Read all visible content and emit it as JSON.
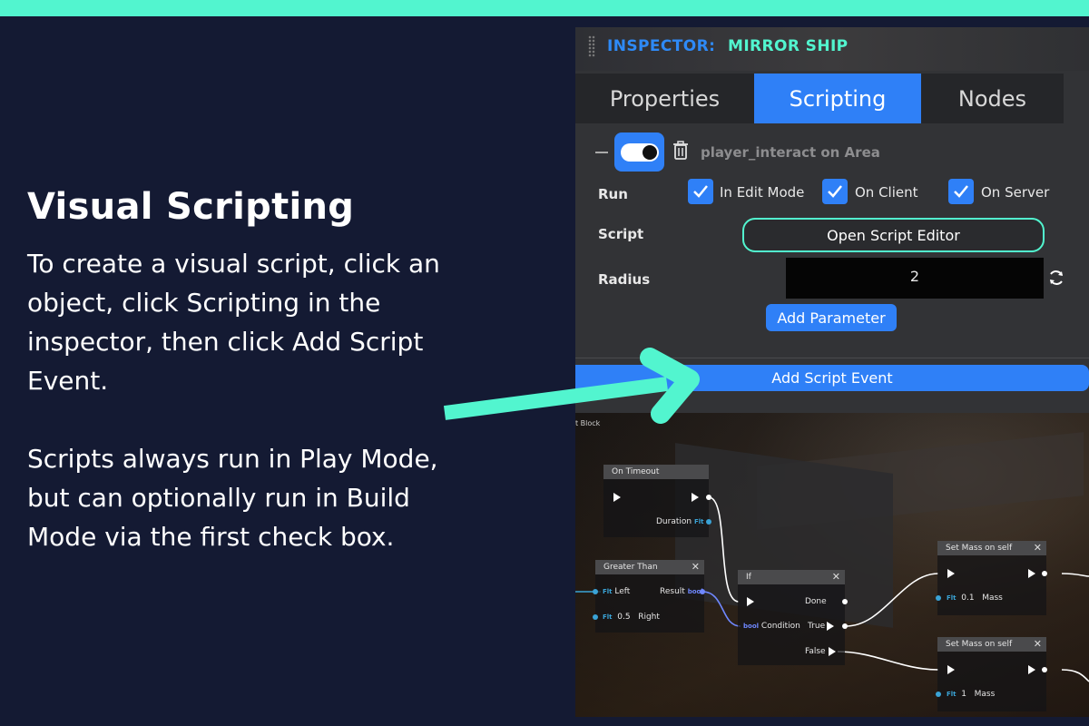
{
  "colors": {
    "accent_teal": "#52f5cf",
    "accent_blue": "#2f80f7",
    "background": "#141a33"
  },
  "tutorial": {
    "title": "Visual Scripting",
    "paragraph1": "To create a visual script, click an object, click Scripting in the inspector, then click Add Script Event.",
    "paragraph2": "Scripts always run in Play Mode, but can optionally run in Build Mode via the first check box."
  },
  "inspector": {
    "title": "INSPECTOR:",
    "object_name": "MIRROR SHIP",
    "tabs": [
      {
        "label": "Properties",
        "active": false
      },
      {
        "label": "Scripting",
        "active": true
      },
      {
        "label": "Nodes",
        "active": false
      }
    ],
    "event": {
      "name": "player_interact on Area",
      "enabled": true,
      "run_label": "Run",
      "run_options": [
        {
          "label": "In Edit Mode",
          "checked": true
        },
        {
          "label": "On Client",
          "checked": true
        },
        {
          "label": "On Server",
          "checked": true
        }
      ],
      "script_label": "Script",
      "open_script_editor": "Open Script Editor",
      "radius_label": "Radius",
      "radius_value": "2",
      "add_parameter": "Add Parameter"
    },
    "add_script_event": "Add Script Event"
  },
  "graph": {
    "corner_label": "t Block",
    "type_tags": {
      "float": "Flt",
      "bool": "bool"
    },
    "nodes": {
      "on_timeout": {
        "title": "On Timeout",
        "duration_label": "Duration"
      },
      "greater_than": {
        "title": "Greater Than",
        "left_label": "Left",
        "right_label": "Right",
        "right_value": "0.5",
        "result_label": "Result"
      },
      "if": {
        "title": "If",
        "condition_label": "Condition",
        "done_label": "Done",
        "true_label": "True",
        "false_label": "False"
      },
      "set_mass_1": {
        "title": "Set Mass on self",
        "mass_label": "Mass",
        "mass_value": "0.1"
      },
      "set_mass_2": {
        "title": "Set Mass on self",
        "mass_label": "Mass",
        "mass_value": "1"
      }
    }
  }
}
